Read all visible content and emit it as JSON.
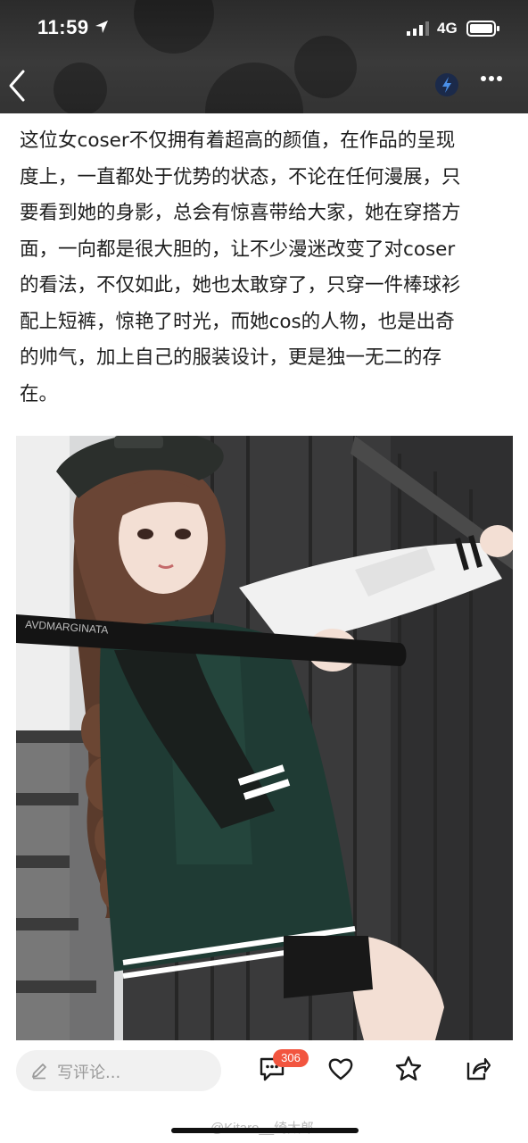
{
  "status_bar": {
    "time": "11:59",
    "network": "4G"
  },
  "nav": {
    "back_icon": "chevron-left-icon",
    "more_icon": "ellipsis-icon"
  },
  "article": {
    "lines": [
      "这位女coser不仅拥有着超高的颜值，在作品的呈现",
      "度上，一直都处于优势的状态，不论在任何漫展，只",
      "要看到她的身影，总会有惊喜带给大家，她在穿搭方",
      "面，一向都是很大胆的，让不少漫迷改变了对coser",
      "的看法，不仅如此，她也太敢穿了，只穿一件棒球衫",
      "配上短裤，惊艳了时光，而她cos的人物，也是出奇",
      "的帅气，加上自己的服装设计，更是独一无二的存",
      "在。"
    ]
  },
  "photo": {
    "bat_text": "AVDMARGINATA"
  },
  "bottom_bar": {
    "comment_placeholder": "写评论...",
    "comment_count": "306"
  },
  "watermark": "@Kitaro__绮太郎",
  "colors": {
    "badge": "#f2553f",
    "text": "#1e1e1e"
  }
}
